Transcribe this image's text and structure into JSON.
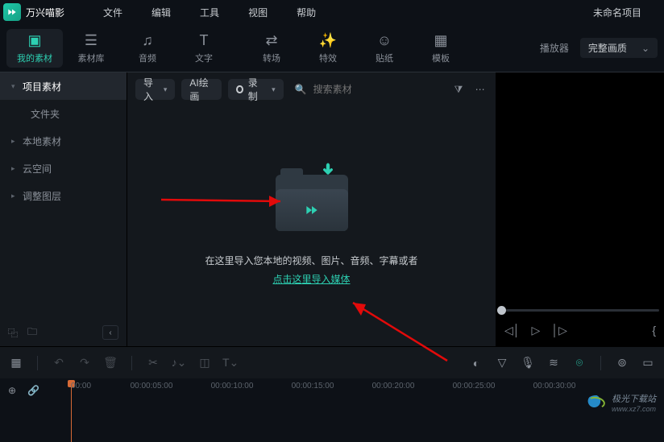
{
  "app": {
    "name": "万兴喵影"
  },
  "menubar": {
    "items": [
      "文件",
      "编辑",
      "工具",
      "视图",
      "帮助"
    ],
    "project_title": "未命名项目"
  },
  "tooltabs": {
    "items": [
      {
        "label": "我的素材",
        "icon": "layers-icon",
        "glyph": "▣"
      },
      {
        "label": "素材库",
        "icon": "library-icon",
        "glyph": "☰"
      },
      {
        "label": "音频",
        "icon": "music-icon",
        "glyph": "♫"
      },
      {
        "label": "文字",
        "icon": "text-icon",
        "glyph": "T"
      },
      {
        "label": "转场",
        "icon": "transition-icon",
        "glyph": "⇄"
      },
      {
        "label": "特效",
        "icon": "sparkle-icon",
        "glyph": "✨"
      },
      {
        "label": "贴纸",
        "icon": "sticker-icon",
        "glyph": "☺"
      },
      {
        "label": "模板",
        "icon": "template-icon",
        "glyph": "▦"
      }
    ],
    "player_label": "播放器",
    "quality_label": "完整画质"
  },
  "sidebar": {
    "items": [
      {
        "label": "项目素材",
        "expanded": true
      },
      {
        "label": "文件夹",
        "is_folder": true
      },
      {
        "label": "本地素材"
      },
      {
        "label": "云空间"
      },
      {
        "label": "调整图层"
      }
    ]
  },
  "center_toolbar": {
    "import_label": "导入",
    "ai_label": "AI绘画",
    "record_label": "录制",
    "search_placeholder": "搜索素材"
  },
  "import_zone": {
    "hint": "在这里导入您本地的视频、图片、音频、字幕或者",
    "link": "点击这里导入媒体"
  },
  "timeline": {
    "ruler": [
      "00:00",
      "00:00:05:00",
      "00:00:10:00",
      "00:00:15:00",
      "00:00:20:00",
      "00:00:25:00",
      "00:00:30:00"
    ]
  },
  "watermark": {
    "site": "极光下载站",
    "url": "www.xz7.com"
  }
}
